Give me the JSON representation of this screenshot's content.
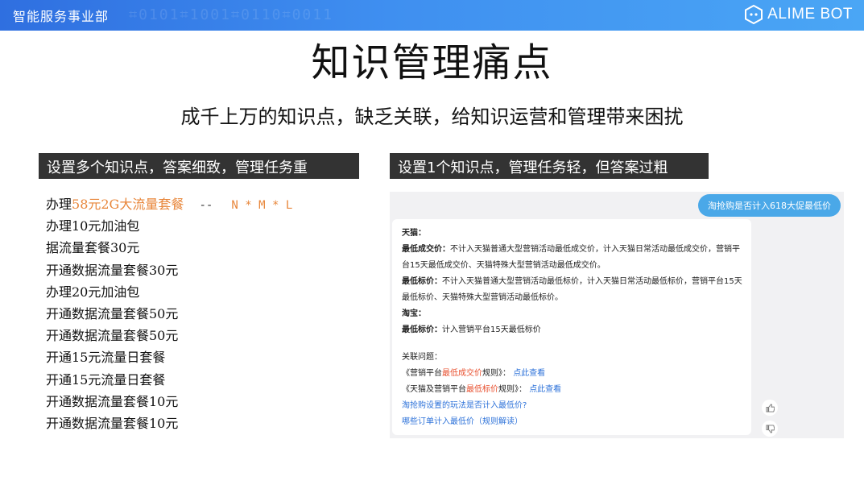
{
  "header": {
    "department": "智能服务事业部",
    "brand": "ALIME BOT"
  },
  "slide": {
    "title": "知识管理痛点",
    "subtitle": "成千上万的知识点，缺乏关联，给知识运营和管理带来困扰"
  },
  "left_panel": {
    "label": "设置多个知识点，答案细致，管理任务重",
    "first_item": {
      "prefix": "办理",
      "highlight": "58元2G大流量套餐",
      "dash": "--",
      "code": "N * M * L"
    },
    "items": [
      "办理10元加油包",
      "据流量套餐30元",
      "开通数据流量套餐30元",
      "办理20元加油包",
      "开通数据流量套餐50元",
      "开通数据流量套餐50元",
      "开通15元流量日套餐",
      "开通15元流量日套餐",
      "开通数据流量套餐10元",
      "开通数据流量套餐10元"
    ]
  },
  "right_panel": {
    "label": "设置1个知识点，管理任务轻，但答案过粗",
    "question": "淘抢购是否计入618大促最低价",
    "answer": {
      "tmall_title": "天猫：",
      "line1_label": "最低成交价：",
      "line1_text": "不计入天猫普通大型营销活动最低成交价，计入天猫日常活动最低成交价，营销平",
      "line2_text": "台15天最低成交价、天猫特殊大型营销活动最低成交价。",
      "line3_label": "最低标价：",
      "line3_text": "不计入天猫普通大型营销活动最低标价，计入天猫日常活动最低标价，营销平台15天",
      "line4_text": "最低标价、天猫特殊大型营销活动最低标价。",
      "taobao_title": "淘宝：",
      "line5_label": "最低标价：",
      "line5_text": "计入营销平台15天最低标价",
      "related_title": "关联问题：",
      "rel1_pre": "《营销平台",
      "rel1_red": "最低成交价",
      "rel1_post": "规则》：",
      "rel1_link": "点此查看",
      "rel2_pre": "《天猫及营销平台",
      "rel2_red": "最低标价",
      "rel2_post": "规则》：",
      "rel2_link": "点此查看",
      "rel3": "淘抢购设置的玩法是否计入最低价?",
      "rel4": "哪些订单计入最低价（规则解读）"
    },
    "feedback_icons": [
      "thumbs-up-icon",
      "thumbs-down-icon"
    ]
  },
  "colors": {
    "header_start": "#2f6fe0",
    "header_end": "#4aa6f5",
    "label_bg": "#333333",
    "highlight": "#e8863a",
    "question_bubble": "#4aa8e8",
    "answer_red": "#e8502f",
    "answer_link": "#2d72d9"
  }
}
